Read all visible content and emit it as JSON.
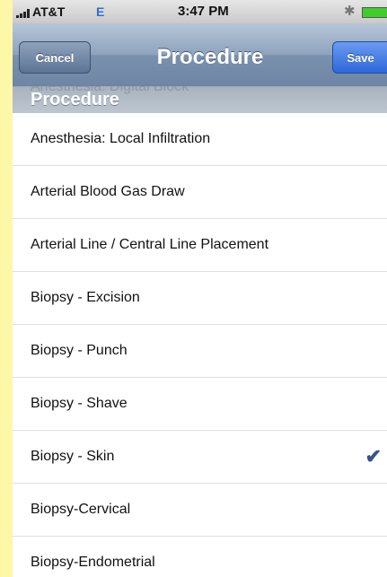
{
  "status_bar": {
    "carrier": "AT&T",
    "network": "E",
    "time": "3:47 PM",
    "icons": [
      "signal-icon",
      "bluetooth-icon",
      "battery-icon"
    ]
  },
  "nav": {
    "cancel_label": "Cancel",
    "title": "Procedure",
    "save_label": "Save"
  },
  "section": {
    "header": "Procedure",
    "faded_previous": "Anesthesia: Digital Block"
  },
  "items": [
    {
      "label": "Anesthesia: Local Infiltration",
      "checked": false
    },
    {
      "label": "Arterial Blood Gas Draw",
      "checked": false
    },
    {
      "label": "Arterial Line / Central Line Placement",
      "checked": false
    },
    {
      "label": "Biopsy - Excision",
      "checked": false
    },
    {
      "label": "Biopsy - Punch",
      "checked": false
    },
    {
      "label": "Biopsy - Shave",
      "checked": false
    },
    {
      "label": "Biopsy - Skin",
      "checked": true
    },
    {
      "label": "Biopsy-Cervical",
      "checked": false
    },
    {
      "label": "Biopsy-Endometrial",
      "checked": false
    }
  ],
  "colors": {
    "page_background": "#fdf7a8",
    "nav_bar": "#8ea3bd",
    "save_button": "#2f68db",
    "checkmark": "#385487"
  }
}
